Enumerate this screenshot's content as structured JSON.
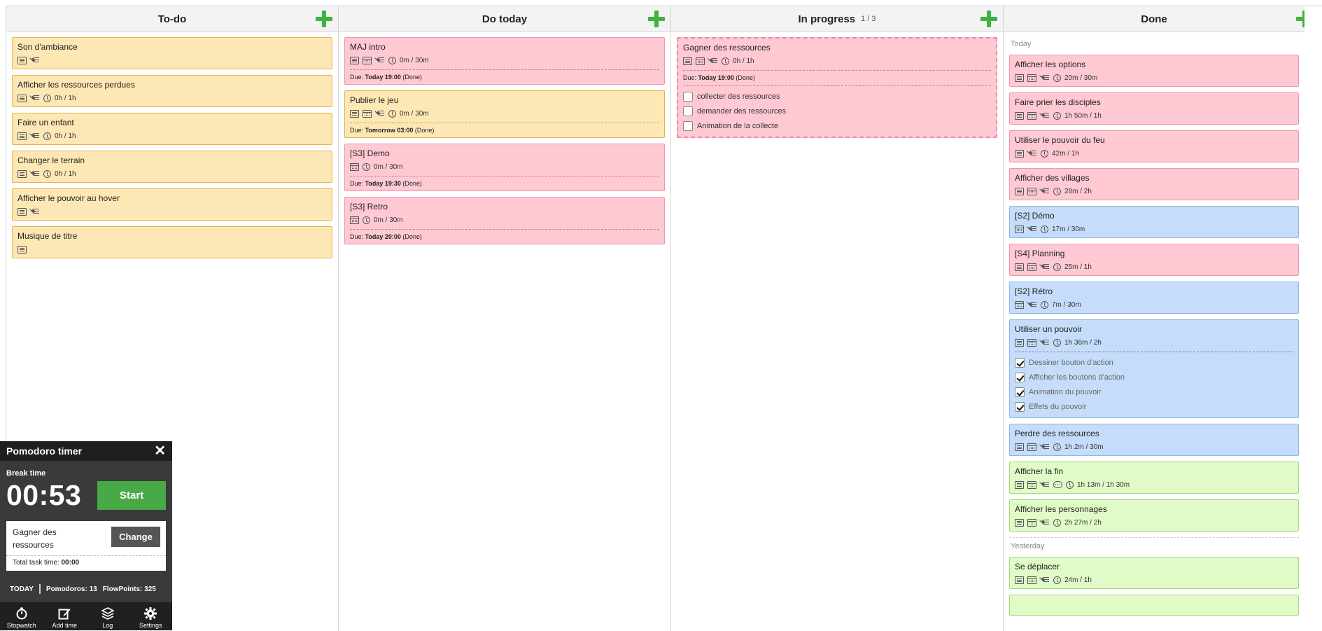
{
  "columns": {
    "todo": {
      "title": "To-do",
      "cards": [
        {
          "title": "Son d'ambiance",
          "time": ""
        },
        {
          "title": "Afficher les ressources perdues",
          "time": "0h / 1h"
        },
        {
          "title": "Faire un enfant",
          "time": "0h / 1h"
        },
        {
          "title": "Changer le terrain",
          "time": "0h / 1h"
        },
        {
          "title": "Afficher le pouvoir au hover",
          "time": ""
        },
        {
          "title": "Musique de titre",
          "time": ""
        }
      ]
    },
    "today": {
      "title": "Do today",
      "cards": [
        {
          "title": "MAJ intro",
          "time": "0m / 30m",
          "due_label": "Due:",
          "due_date": "Today 19:00",
          "due_status": "(Done)"
        },
        {
          "title": "Publier le jeu",
          "time": "0m / 30m",
          "due_label": "Due:",
          "due_date": "Tomorrow 03:00",
          "due_status": "(Done)"
        },
        {
          "title": "[S3] Demo",
          "time": "0m / 30m",
          "due_label": "Due:",
          "due_date": "Today 19:30",
          "due_status": "(Done)"
        },
        {
          "title": "[S3] Retro",
          "time": "0m / 30m",
          "due_label": "Due:",
          "due_date": "Today 20:00",
          "due_status": "(Done)"
        }
      ]
    },
    "progress": {
      "title": "In progress",
      "count": "1 / 3",
      "card": {
        "title": "Gagner des ressources",
        "time": "0h / 1h",
        "due_label": "Due:",
        "due_date": "Today 19:00",
        "due_status": "(Done)",
        "subtasks": [
          "collecter des ressources",
          "demander des ressources",
          "Animation de la collecte"
        ]
      }
    },
    "done": {
      "title": "Done",
      "today_label": "Today",
      "yesterday_label": "Yesterday",
      "cards": [
        {
          "title": "Afficher les options",
          "time": "20m / 30m"
        },
        {
          "title": "Faire prier les disciples",
          "time": "1h 50m / 1h"
        },
        {
          "title": "Utiliser le pouvoir du feu",
          "time": "42m / 1h"
        },
        {
          "title": "Afficher des villages",
          "time": "28m / 2h"
        },
        {
          "title": "[S2] Démo",
          "time": "17m / 30m"
        },
        {
          "title": "[S4] Planning",
          "time": "25m / 1h"
        },
        {
          "title": "[S2] Rétro",
          "time": "7m / 30m"
        },
        {
          "title": "Utiliser un pouvoir",
          "time": "1h 36m / 2h",
          "subtasks": [
            "Dessiner bouton d'action",
            "Afficher les boutons d'action",
            "Animation du pouvoir",
            "Effets du pouvoir"
          ]
        },
        {
          "title": "Perdre des ressources",
          "time": "1h 2m / 30m"
        },
        {
          "title": "Afficher la fin",
          "time": "1h 13m / 1h 30m"
        },
        {
          "title": "Afficher les personnages",
          "time": "2h 27m / 2h"
        }
      ],
      "yesterday_cards": [
        {
          "title": "Se déplacer",
          "time": "24m / 1h"
        }
      ]
    }
  },
  "pomodoro": {
    "title": "Pomodoro timer",
    "mode_label": "Break time",
    "time": "00:53",
    "start_label": "Start",
    "task_name": "Gagner des ressources",
    "change_label": "Change",
    "total_label": "Total task time:",
    "total_value": "00:00",
    "today_label": "TODAY",
    "pomodoros_label": "Pomodoros:",
    "pomodoros_value": "13",
    "flowpoints_label": "FlowPoints:",
    "flowpoints_value": "325",
    "nav": [
      "Stopwatch",
      "Add time",
      "Log",
      "Settings"
    ]
  },
  "colors": {
    "yellow": "#fde7b5",
    "pink": "#ffc9d3",
    "blue": "#c5ddfa",
    "green": "#e0fbc7",
    "add": "#3fb33f",
    "start": "#48a947"
  }
}
